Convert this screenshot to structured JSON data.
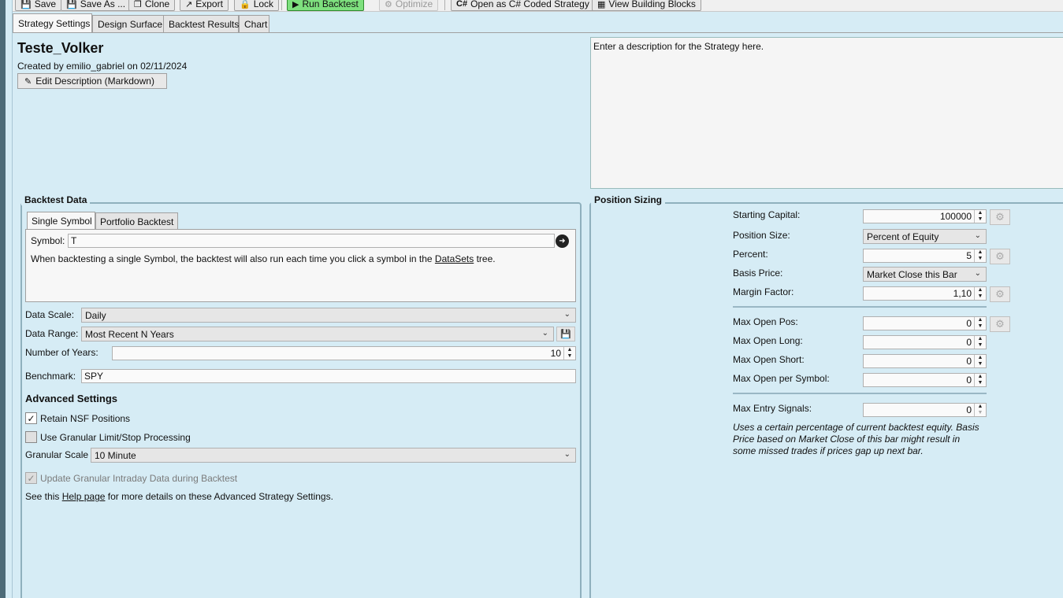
{
  "toolbar": {
    "save": "Save",
    "save_as": "Save As ...",
    "clone": "Clone",
    "export": "Export",
    "lock": "Lock",
    "run_backtest": "Run Backtest",
    "optimize": "Optimize",
    "open_csharp": "Open as C# Coded Strategy",
    "view_blocks": "View Building Blocks"
  },
  "tabs": [
    "Strategy Settings",
    "Design Surface",
    "Backtest Results",
    "Chart"
  ],
  "strategy": {
    "name": "Teste_Volker",
    "created": "Created by emilio_gabriel on 02/11/2024",
    "edit_description": "Edit Description (Markdown)",
    "description": "Enter a description for the Strategy here."
  },
  "backtest": {
    "group_label": "Backtest Data",
    "subtabs": [
      "Single Symbol",
      "Portfolio Backtest"
    ],
    "symbol_label": "Symbol:",
    "symbol_value": "T",
    "hint_before": "When backtesting a single Symbol, the backtest will also run each time you click a symbol in the ",
    "hint_link": "DataSets",
    "hint_after": " tree.",
    "data_scale_label": "Data Scale:",
    "data_scale_value": "Daily",
    "data_range_label": "Data Range:",
    "data_range_value": "Most Recent N Years",
    "years_label": "Number of Years:",
    "years_value": "10",
    "benchmark_label": "Benchmark:",
    "benchmark_value": "SPY"
  },
  "advanced": {
    "heading": "Advanced Settings",
    "retain_nsf": "Retain NSF Positions",
    "use_granular": "Use Granular Limit/Stop Processing",
    "granular_scale_label": "Granular Scale",
    "granular_scale_value": "10 Minute",
    "update_granular": "Update Granular Intraday Data during Backtest",
    "help_before": "See this ",
    "help_link": "Help page",
    "help_after": " for more details on these Advanced Strategy Settings."
  },
  "position_sizing": {
    "group_label": "Position Sizing",
    "starting_capital_label": "Starting Capital:",
    "starting_capital_value": "100000",
    "position_size_label": "Position Size:",
    "position_size_value": "Percent of Equity",
    "percent_label": "Percent:",
    "percent_value": "5",
    "basis_price_label": "Basis Price:",
    "basis_price_value": "Market Close this Bar",
    "margin_factor_label": "Margin Factor:",
    "margin_factor_value": "1,10",
    "max_open_pos_label": "Max Open Pos:",
    "max_open_pos_value": "0",
    "max_open_long_label": "Max Open Long:",
    "max_open_long_value": "0",
    "max_open_short_label": "Max Open Short:",
    "max_open_short_value": "0",
    "max_open_symbol_label": "Max Open per Symbol:",
    "max_open_symbol_value": "0",
    "max_entry_label": "Max Entry Signals:",
    "max_entry_value": "0",
    "note": "Uses a certain percentage of current backtest equity. Basis Price based on Market Close of this bar might result in some missed trades if prices gap up next bar."
  }
}
